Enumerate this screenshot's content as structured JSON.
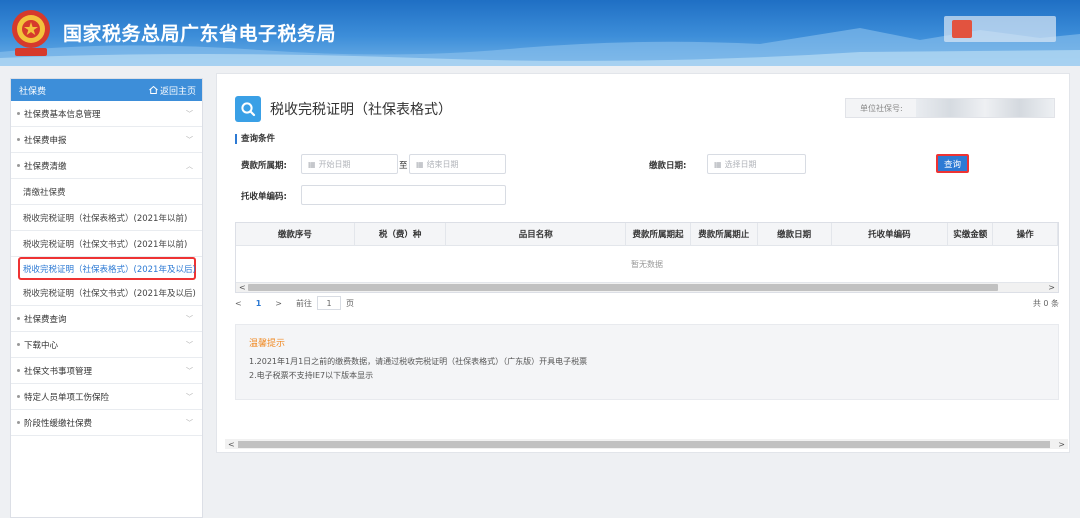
{
  "header": {
    "title": "国家税务总局广东省电子税务局"
  },
  "sidebar": {
    "title": "社保费",
    "home_label": "返回主页",
    "items": [
      {
        "label": "社保费基本信息管理",
        "type": "group"
      },
      {
        "label": "社保费申报",
        "type": "group"
      },
      {
        "label": "社保费清缴",
        "type": "group-open"
      },
      {
        "label": "清缴社保费",
        "type": "sub"
      },
      {
        "label": "税收完税证明（社保表格式）(2021年以前)",
        "type": "sub"
      },
      {
        "label": "税收完税证明（社保文书式）(2021年以前)",
        "type": "sub"
      },
      {
        "label": "税收完税证明（社保表格式）(2021年及以后)",
        "type": "sub-selected"
      },
      {
        "label": "税收完税证明（社保文书式）(2021年及以后)",
        "type": "sub"
      },
      {
        "label": "社保费查询",
        "type": "group"
      },
      {
        "label": "下载中心",
        "type": "group"
      },
      {
        "label": "社保文书事项管理",
        "type": "group"
      },
      {
        "label": "特定人员单项工伤保险",
        "type": "group"
      },
      {
        "label": "阶段性缓缴社保费",
        "type": "group"
      }
    ]
  },
  "main": {
    "title": "税收完税证明（社保表格式）",
    "account_label": "单位社保号:",
    "query_section": "查询条件",
    "fee_period_label": "费款所属期:",
    "start_placeholder": "开始日期",
    "range_sep": "至",
    "end_placeholder": "结束日期",
    "pay_date_label": "缴款日期:",
    "pay_date_placeholder": "选择日期",
    "query_button": "查询",
    "entrust_label": "托收单编码:",
    "table": {
      "columns": [
        "缴款序号",
        "税（费）种",
        "品目名称",
        "费款所属期起",
        "费款所属期止",
        "缴款日期",
        "托收单编码",
        "实缴金额",
        "操作"
      ],
      "empty_text": "暂无数据"
    },
    "pagination": {
      "current": "1",
      "goto_label": "前往",
      "goto_value": "1",
      "page_unit": "页",
      "total": "共 0 条"
    },
    "tips": {
      "title": "温馨提示",
      "lines": [
        "1.2021年1月1日之前的缴费数据，请通过税收完税证明（社保表格式）（广东版）开具电子税票",
        "2.电子税票不支持IE7以下版本显示"
      ]
    }
  },
  "colors": {
    "primary": "#2d7ad4",
    "highlight_border": "#ee3333",
    "tip_title": "#f08a24"
  }
}
